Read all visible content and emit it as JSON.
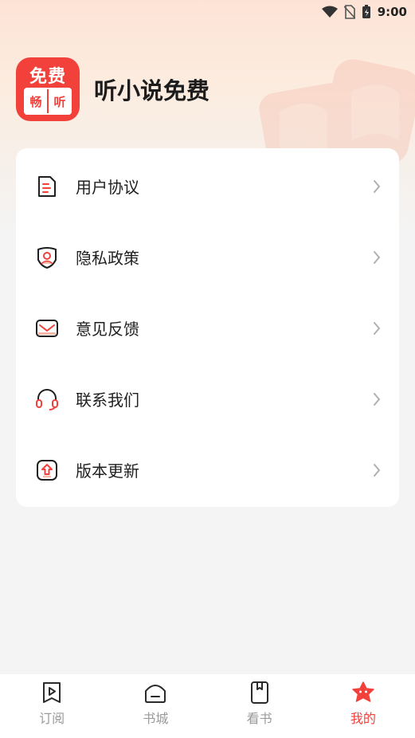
{
  "status_bar": {
    "time": "9:00"
  },
  "app": {
    "name": "听小说免费",
    "logo_top": "免费",
    "logo_left": "畅",
    "logo_right": "听"
  },
  "menu": [
    {
      "label": "用户协议",
      "icon": "document-icon"
    },
    {
      "label": "隐私政策",
      "icon": "privacy-shield-icon"
    },
    {
      "label": "意见反馈",
      "icon": "mail-icon"
    },
    {
      "label": "联系我们",
      "icon": "headset-icon"
    },
    {
      "label": "版本更新",
      "icon": "update-arrow-icon"
    }
  ],
  "tabs": [
    {
      "label": "订阅",
      "icon": "bookmark-play-icon",
      "active": false
    },
    {
      "label": "书城",
      "icon": "home-icon",
      "active": false
    },
    {
      "label": "看书",
      "icon": "book-icon",
      "active": false
    },
    {
      "label": "我的",
      "icon": "star-face-icon",
      "active": true
    }
  ],
  "colors": {
    "accent": "#f2413b",
    "text": "#1f1f1f",
    "inactive": "#9a9a9a",
    "background": "#f4f4f4"
  }
}
